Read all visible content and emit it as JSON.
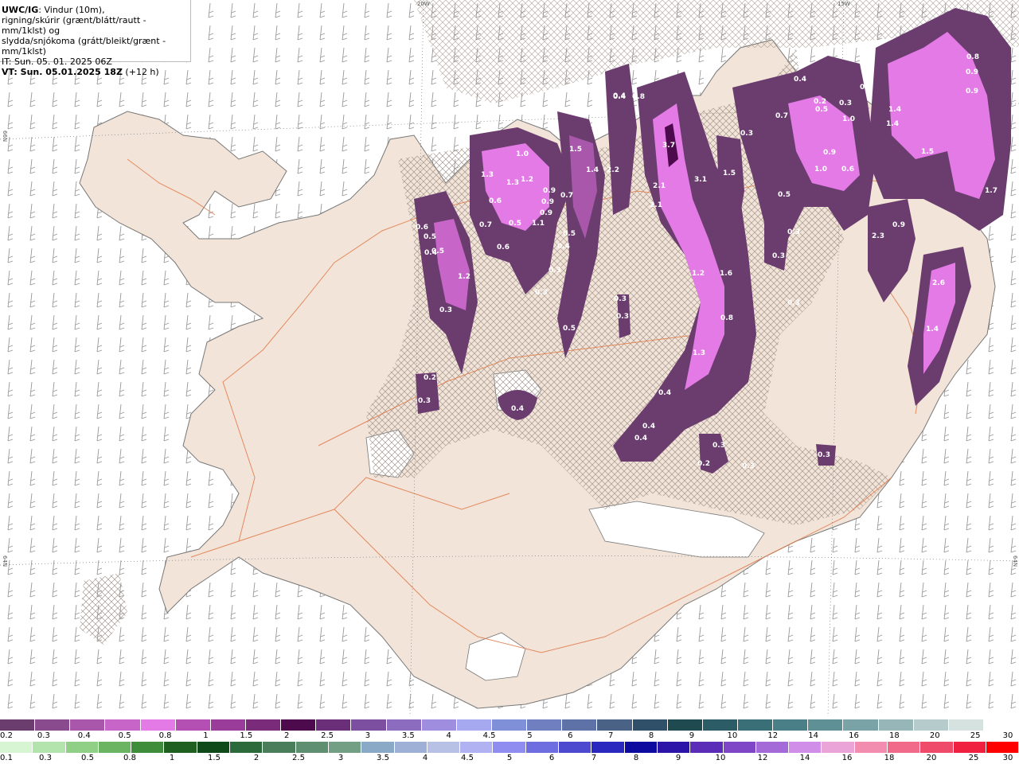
{
  "header": {
    "title_bold": "UWC/IG",
    "title_rest": ": Vindur (10m),",
    "line2": "rigning/skúrir (grænt/blátt/rautt - mm/1klst) og",
    "line3": "slydda/snjókoma (grátt/bleikt/grænt - mm/1klst)",
    "it_line": "IT: Sun. 05. 01. 2025 06Z",
    "vt_bold": "VT: Sun. 05.01.2025 18Z",
    "vt_rest": " (+12 h)"
  },
  "edge_labels": {
    "top_20w": "20W",
    "top_15w": "15W",
    "left_66n": "66N",
    "left_64n": "64N",
    "right_64n": "64N"
  },
  "precip_labels": [
    "1.0",
    "1.3",
    "1.3",
    "1.2",
    "0.9",
    "0.7",
    "0.9",
    "0.9",
    "0.7",
    "0.5",
    "0.6",
    "0.5",
    "1.1",
    "0.6",
    "0.6",
    "0.5",
    "1.2",
    "0.3",
    "0.4",
    "0.3",
    "0.3",
    "0.5",
    "0.4",
    "0.2",
    "0.3",
    "0.4",
    "1.5",
    "1.4",
    "2.2",
    "0.4",
    "0.8",
    "3.7",
    "2.1",
    "2.1",
    "3.1",
    "1.5",
    "1.2",
    "1.6",
    "0.8",
    "1.3",
    "0.4",
    "0.4",
    "0.4",
    "0.3",
    "0.2",
    "0.3",
    "0.3",
    "0.7",
    "0.5",
    "0.3",
    "0.5",
    "0.3",
    "0.3",
    "1.0",
    "0.9",
    "1.0",
    "0.6",
    "1.4",
    "1.4",
    "1.5",
    "0.8",
    "0.9",
    "0.9",
    "1.7",
    "2.3",
    "0.9",
    "2.6",
    "1.4",
    "0.3",
    "0.3",
    "0.3",
    "0.5",
    "0.2",
    "0.3",
    "0.4",
    "0.5",
    "0.4"
  ],
  "legend_snow": {
    "colors": [
      "#6a3d6e",
      "#8a4a8e",
      "#a857ab",
      "#c766c8",
      "#e47ae6",
      "#b44fb4",
      "#9a3d9a",
      "#7a2b7a",
      "#4d0a4d",
      "#6b2f7a",
      "#7c4fa0",
      "#8c6cbf",
      "#9f8de0",
      "#a6a8f0",
      "#7f90d8",
      "#6f7fc0",
      "#5f72a8",
      "#4a6286",
      "#2f5068",
      "#1e4a50",
      "#2c5d66",
      "#3a6f78",
      "#4b7f88",
      "#5f9096",
      "#79a3a6",
      "#96b6b7",
      "#b6cccc",
      "#d6e2e0",
      "#ffffff"
    ],
    "labels": [
      "0.2",
      "0.3",
      "0.4",
      "0.5",
      "0.8",
      "1",
      "1.5",
      "2",
      "2.5",
      "3",
      "3.5",
      "4",
      "4.5",
      "5",
      "6",
      "7",
      "8",
      "9",
      "10",
      "12",
      "14",
      "16",
      "18",
      "20",
      "25",
      "30"
    ]
  },
  "legend_rain": {
    "colors": [
      "#d7f5d3",
      "#b4e4ad",
      "#8fcf86",
      "#6bb562",
      "#3f8c3b",
      "#1f5f1f",
      "#0f4a1a",
      "#2c6a3c",
      "#4a7e5a",
      "#5e8f70",
      "#739f84",
      "#8aa9c6",
      "#9fb0d6",
      "#b7c1e6",
      "#b1b2f2",
      "#8f8ef0",
      "#6f6ee0",
      "#4d4ad0",
      "#2b28c0",
      "#0d0aa0",
      "#2d14a8",
      "#5a2cb8",
      "#7f47c8",
      "#a46ad8",
      "#d08ee8",
      "#eaa4d8",
      "#f28db0",
      "#f26a8a",
      "#f04a6a",
      "#f02040",
      "#ff0000"
    ],
    "labels": [
      "0.1",
      "0.3",
      "0.5",
      "0.8",
      "1",
      "1.5",
      "2",
      "2.5",
      "3",
      "3.5",
      "4",
      "4.5",
      "5",
      "6",
      "7",
      "8",
      "9",
      "10",
      "12",
      "14",
      "16",
      "18",
      "20",
      "25",
      "30"
    ]
  }
}
